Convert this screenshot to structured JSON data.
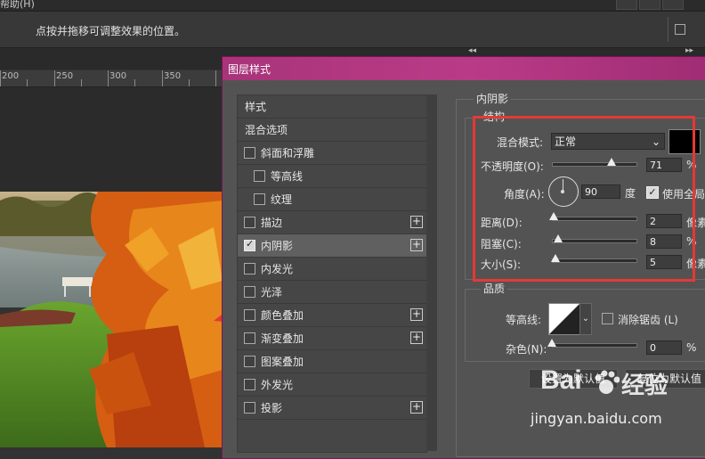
{
  "menubar": {
    "help_label": "帮助(H)"
  },
  "optionsbar": {
    "hint": "点按并拖移可调整效果的位置。"
  },
  "ruler": {
    "ticks": [
      "200",
      "250",
      "300",
      "350"
    ]
  },
  "dialog": {
    "title": "图层样式",
    "styles": [
      {
        "label": "样式",
        "checkbox": false
      },
      {
        "label": "混合选项",
        "checkbox": false
      },
      {
        "label": "斜面和浮雕",
        "checkbox": true,
        "checked": false
      },
      {
        "label": "等高线",
        "checkbox": true,
        "checked": false,
        "indent": true
      },
      {
        "label": "纹理",
        "checkbox": true,
        "checked": false,
        "indent": true
      },
      {
        "label": "描边",
        "checkbox": true,
        "checked": false,
        "plus": true
      },
      {
        "label": "内阴影",
        "checkbox": true,
        "checked": true,
        "plus": true,
        "selected": true
      },
      {
        "label": "内发光",
        "checkbox": true,
        "checked": false
      },
      {
        "label": "光泽",
        "checkbox": true,
        "checked": false
      },
      {
        "label": "颜色叠加",
        "checkbox": true,
        "checked": false,
        "plus": true
      },
      {
        "label": "渐变叠加",
        "checkbox": true,
        "checked": false,
        "plus": true
      },
      {
        "label": "图案叠加",
        "checkbox": true,
        "checked": false
      },
      {
        "label": "外发光",
        "checkbox": true,
        "checked": false
      },
      {
        "label": "投影",
        "checkbox": true,
        "checked": false,
        "plus": true
      }
    ],
    "inner_shadow": {
      "heading": "内阴影",
      "structure_heading": "结构",
      "blend_mode_label": "混合模式:",
      "blend_mode_value": "正常",
      "shadow_color": "#000000",
      "opacity_label": "不透明度(O):",
      "opacity_value": "71",
      "opacity_fraction": 0.71,
      "percent": "%",
      "angle_label": "角度(A):",
      "angle_value": "90",
      "degree_unit": "度",
      "global_light_label": "使用全局",
      "global_light_checked": true,
      "distance_label": "距离(D):",
      "distance_value": "2",
      "choke_label": "阻塞(C):",
      "choke_value": "8",
      "size_label": "大小(S):",
      "size_value": "5",
      "px_unit": "像素",
      "quality_heading": "品质",
      "contour_label": "等高线:",
      "antialias_label": "消除锯齿 (L)",
      "noise_label": "杂色(N):",
      "noise_value": "0",
      "set_default_label": "设置为默认值",
      "reset_default_label": "复位为默认值"
    }
  },
  "watermark": {
    "brand_left": "Bai",
    "brand_right": "经验",
    "url": "jingyan.baidu.com"
  },
  "colors": {
    "dialog_title": "#b93b87",
    "annotation_red": "#e53935",
    "panel": "#535353"
  }
}
